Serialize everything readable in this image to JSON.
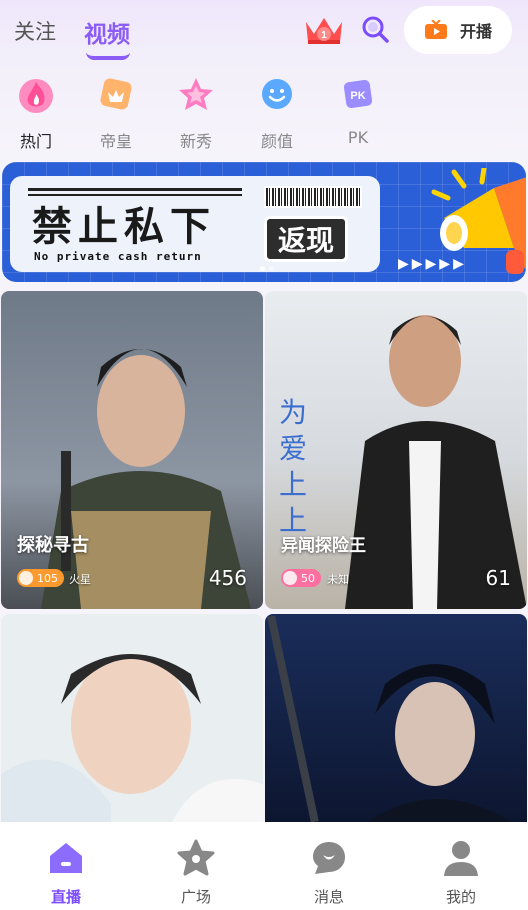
{
  "top_tabs": {
    "follow": "关注",
    "video": "视频"
  },
  "crown_badge": "1",
  "live_button": "开播",
  "categories": [
    {
      "label": "热门",
      "icon": "flame-icon",
      "color": "#ff6fa8"
    },
    {
      "label": "帝皇",
      "icon": "emperor-badge-icon",
      "color": "#ff9b4a"
    },
    {
      "label": "新秀",
      "icon": "star-icon",
      "color": "#ff6fb0"
    },
    {
      "label": "颜值",
      "icon": "smile-face-icon",
      "color": "#4da3ff"
    },
    {
      "label": "PK",
      "icon": "pk-icon",
      "color": "#8b7cff"
    }
  ],
  "banner": {
    "title": "禁止私下",
    "subtitle": "No private  cash return",
    "tag": "返现"
  },
  "rooms": [
    {
      "title": "探秘寻古",
      "level": "105",
      "location": "火星",
      "viewers": "456"
    },
    {
      "title": "异闻探险王",
      "level": "50",
      "location": "未知",
      "viewers": "61"
    },
    {
      "title": "",
      "level": "",
      "location": "",
      "viewers": ""
    },
    {
      "title": "",
      "level": "",
      "location": "",
      "viewers": ""
    }
  ],
  "poster_text": "为爱上上",
  "bottom_nav": [
    {
      "label": "直播",
      "icon": "home-icon"
    },
    {
      "label": "广场",
      "icon": "star-plaza-icon"
    },
    {
      "label": "消息",
      "icon": "message-icon"
    },
    {
      "label": "我的",
      "icon": "person-icon"
    }
  ],
  "colors": {
    "accent": "#8b5cf6",
    "banner_blue": "#2b5fd8"
  }
}
